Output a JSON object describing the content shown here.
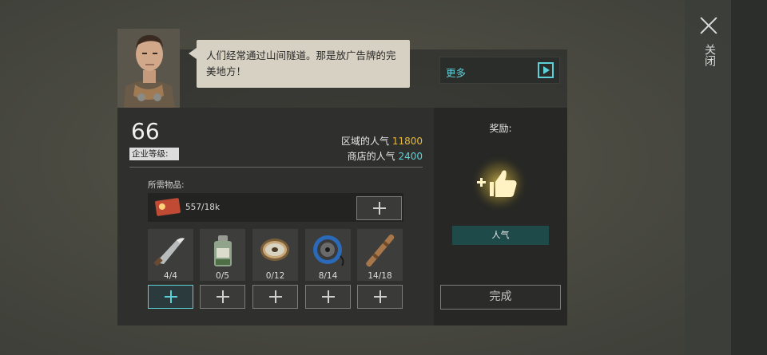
{
  "header": {
    "close_label": "关闭",
    "dialog_text": "人们经常通过山间隧道。那是放广告牌的完美地方！",
    "more_label": "更多"
  },
  "company": {
    "level": "66",
    "level_label": "企业等级:",
    "area_popularity_label": "区域的人气",
    "area_popularity_value": "11800",
    "shop_popularity_label": "商店的人气",
    "shop_popularity_value": "2400"
  },
  "requirements": {
    "label": "所需物品:",
    "currency": {
      "icon": "ticket-icon",
      "amount": "557/18k"
    },
    "items": [
      {
        "icon": "knife-icon",
        "count": "4/4"
      },
      {
        "icon": "jar-icon",
        "count": "0/5"
      },
      {
        "icon": "wire-spool-icon",
        "count": "0/12"
      },
      {
        "icon": "cable-reel-icon",
        "count": "8/14"
      },
      {
        "icon": "wooden-stick-icon",
        "count": "14/18"
      }
    ]
  },
  "reward": {
    "label": "奖励:",
    "icon": "thumbs-up-icon",
    "type": "人气"
  },
  "actions": {
    "complete_label": "完成"
  },
  "colors": {
    "accent": "#5ed0d8",
    "gold": "#e8b838",
    "bubble": "#d7d1c3"
  }
}
